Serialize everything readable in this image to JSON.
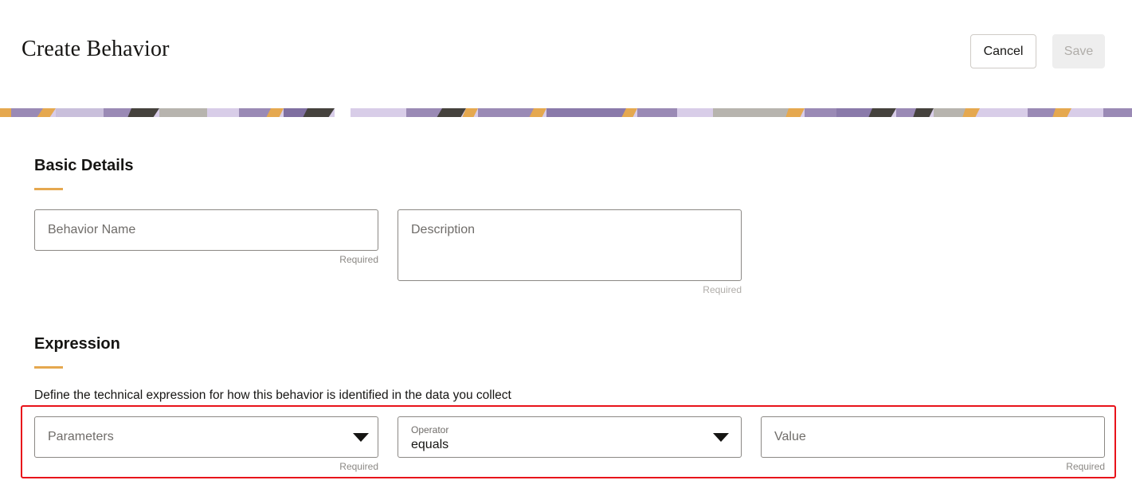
{
  "header": {
    "title": "Create Behavior",
    "cancel_label": "Cancel",
    "save_label": "Save"
  },
  "basic_details": {
    "title": "Basic Details",
    "behavior_name": {
      "placeholder": "Behavior Name",
      "hint": "Required"
    },
    "description": {
      "placeholder": "Description",
      "hint": "Required"
    }
  },
  "expression": {
    "title": "Expression",
    "description": "Define the technical expression for how this behavior is identified in the data you collect",
    "parameters": {
      "placeholder": "Parameters",
      "hint": "Required",
      "icon": "caret-down-icon"
    },
    "operator": {
      "label": "Operator",
      "value": "equals",
      "icon": "caret-down-icon"
    },
    "value": {
      "placeholder": "Value",
      "hint": "Required"
    }
  },
  "colors": {
    "accent": "#e5a84f",
    "highlight": "#e8131a",
    "banner_purple": "#9a8ab5",
    "banner_lilac": "#d8cde8",
    "banner_dark": "#45423d",
    "banner_gray": "#b7b4ae"
  }
}
